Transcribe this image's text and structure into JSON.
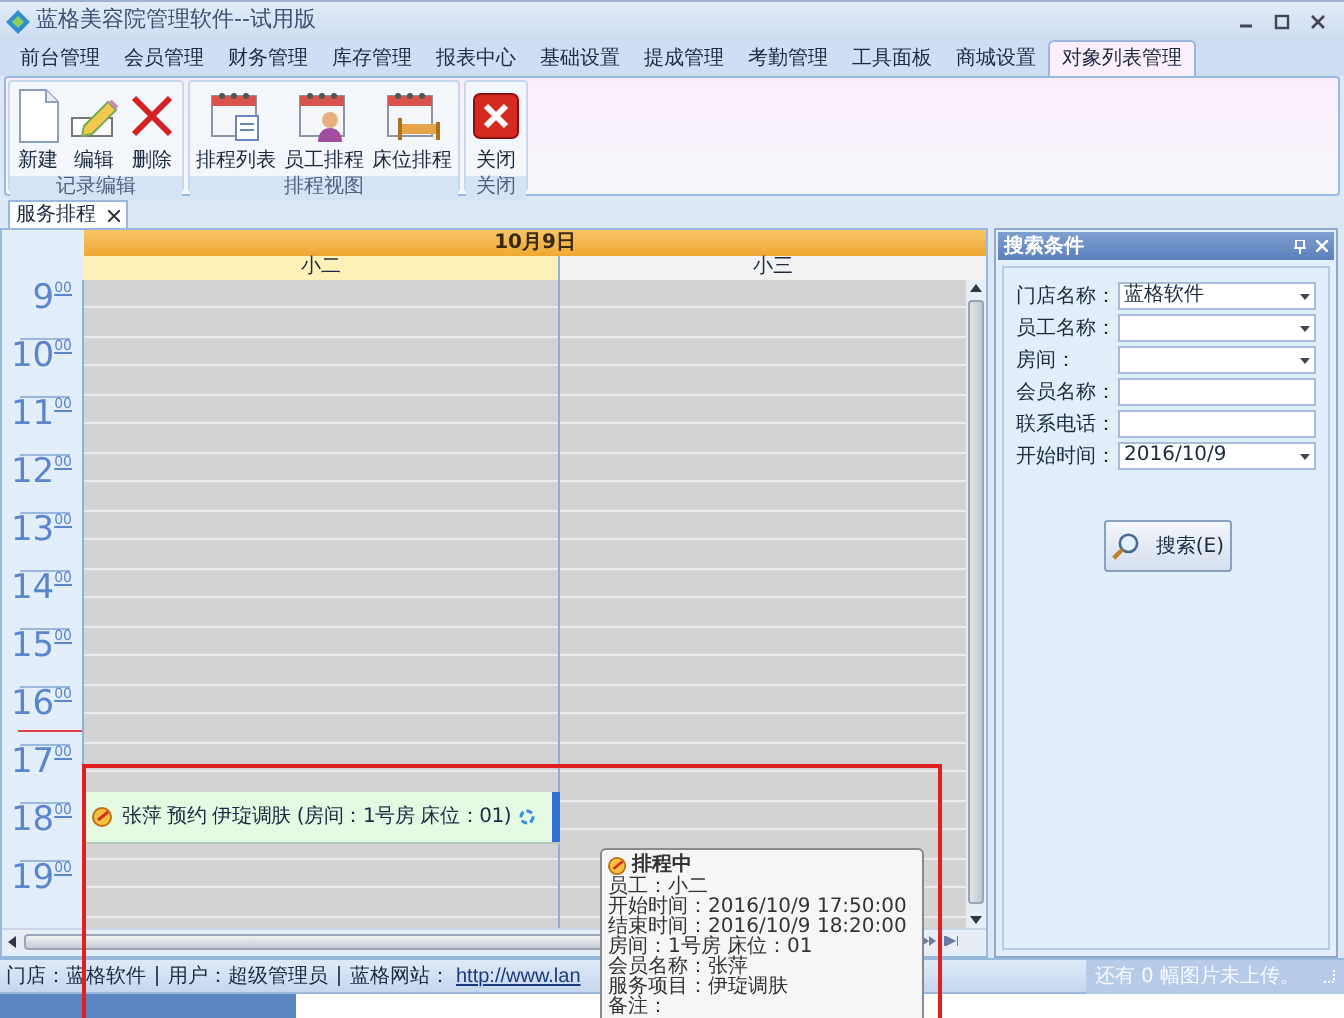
{
  "window": {
    "title": "蓝格美容院管理软件--试用版"
  },
  "menu_tabs": [
    {
      "label": "前台管理",
      "selected": false
    },
    {
      "label": "会员管理",
      "selected": false
    },
    {
      "label": "财务管理",
      "selected": false
    },
    {
      "label": "库存管理",
      "selected": false
    },
    {
      "label": "报表中心",
      "selected": false
    },
    {
      "label": "基础设置",
      "selected": false
    },
    {
      "label": "提成管理",
      "selected": false
    },
    {
      "label": "考勤管理",
      "selected": false
    },
    {
      "label": "工具面板",
      "selected": false
    },
    {
      "label": "商城设置",
      "selected": false
    },
    {
      "label": "对象列表管理",
      "selected": true
    }
  ],
  "ribbon_groups": [
    {
      "title": "记录编辑",
      "buttons": [
        {
          "label": "新建",
          "kind": "new"
        },
        {
          "label": "编辑",
          "kind": "edit"
        },
        {
          "label": "删除",
          "kind": "delete"
        }
      ]
    },
    {
      "title": "排程视图",
      "buttons": [
        {
          "label": "排程列表",
          "kind": "list"
        },
        {
          "label": "员工排程",
          "kind": "staff"
        },
        {
          "label": "床位排程",
          "kind": "bed"
        }
      ]
    },
    {
      "title": "关闭",
      "buttons": [
        {
          "label": "关闭",
          "kind": "close"
        }
      ]
    }
  ],
  "document_tabs": [
    {
      "label": "服务排程",
      "selected": true
    }
  ],
  "scheduler": {
    "date": "10月9日",
    "resources": [
      {
        "name": "小二",
        "selected": true
      },
      {
        "name": "小三",
        "selected": false
      }
    ],
    "hours": [
      {
        "hour": "9",
        "minutes": "00",
        "current": false
      },
      {
        "hour": "10",
        "minutes": "00",
        "current": false
      },
      {
        "hour": "11",
        "minutes": "00",
        "current": false
      },
      {
        "hour": "12",
        "minutes": "00",
        "current": false
      },
      {
        "hour": "13",
        "minutes": "00",
        "current": false
      },
      {
        "hour": "14",
        "minutes": "00",
        "current": false
      },
      {
        "hour": "15",
        "minutes": "00",
        "current": false
      },
      {
        "hour": "16",
        "minutes": "00",
        "current": true
      },
      {
        "hour": "17",
        "minutes": "00",
        "current": false
      },
      {
        "hour": "18",
        "minutes": "00",
        "current": false
      },
      {
        "hour": "19",
        "minutes": "00",
        "current": false
      }
    ],
    "appointment": {
      "text": "张萍 预约 伊琁调肤 (房间：1号房 床位：01)"
    },
    "tooltip": {
      "title": "排程中",
      "lines": [
        "员工：小二",
        "开始时间：2016/10/9 17:50:00",
        "结束时间：2016/10/9 18:20:00",
        "房间：1号房 床位：01",
        "会员名称：张萍",
        "服务项目：伊琁调肤",
        "备注："
      ]
    }
  },
  "search_panel": {
    "title": "搜索条件",
    "fields": [
      {
        "label": "门店名称：",
        "value": "蓝格软件",
        "kind": "dropdown"
      },
      {
        "label": "员工名称：",
        "kind": "dropdown"
      },
      {
        "label": "房间：",
        "kind": "dropdown"
      },
      {
        "label": "会员名称：",
        "kind": "text"
      },
      {
        "label": "联系电话：",
        "kind": "text"
      },
      {
        "label": "开始时间：",
        "value": "2016/10/9",
        "kind": "dropdown"
      }
    ],
    "button": "搜索(E)"
  },
  "status_bar": {
    "items": [
      "门店：蓝格软件",
      "用户：超级管理员",
      "蓝格网站："
    ],
    "link": "http://www.lan",
    "upload_note": "还有 0 幅图片未上传。"
  },
  "progress": {
    "level": 0.22
  }
}
